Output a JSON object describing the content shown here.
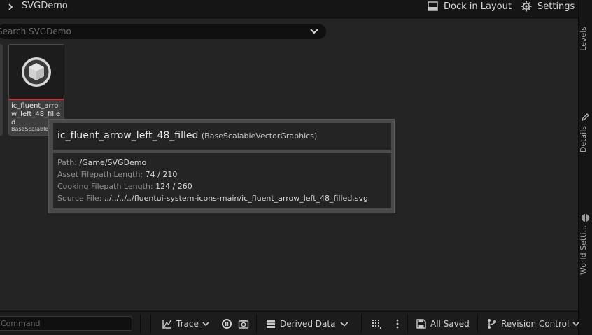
{
  "topbar": {
    "title": "SVGDemo",
    "dock_label": "Dock in Layout",
    "settings_label": "Settings"
  },
  "search": {
    "placeholder": "Search SVGDemo"
  },
  "asset": {
    "name": "ic_fluent_arrow_left_48_filled",
    "class_label": "BaseScalableVectorGraphics",
    "type_color": "#c8303a"
  },
  "tooltip": {
    "title": "ic_fluent_arrow_left_48_filled",
    "class_label": "(BaseScalableVectorGraphics)",
    "rows": [
      {
        "key": "Path:",
        "value": "/Game/SVGDemo"
      },
      {
        "key": "Asset Filepath Length:",
        "value": "74 / 210"
      },
      {
        "key": "Cooking Filepath Length:",
        "value": "124 / 260"
      },
      {
        "key": "Source File:",
        "value": "../../../../fluentui-system-icons-main/ic_fluent_arrow_left_48_filled.svg"
      }
    ]
  },
  "side_tabs": {
    "levels": "Levels",
    "details": "Details",
    "world_settings": "World Setti..."
  },
  "statusbar": {
    "command_placeholder": "Command",
    "trace_label": "Trace",
    "derived_data_label": "Derived Data",
    "all_saved_label": "All Saved",
    "revision_control_label": "Revision Control"
  },
  "icons": {
    "top_chevron": "chevron-right-icon",
    "dock": "dock-icon",
    "settings": "gear-icon",
    "search_dropdown": "chevron-down-icon",
    "asset_thumb": "cube-icon"
  }
}
